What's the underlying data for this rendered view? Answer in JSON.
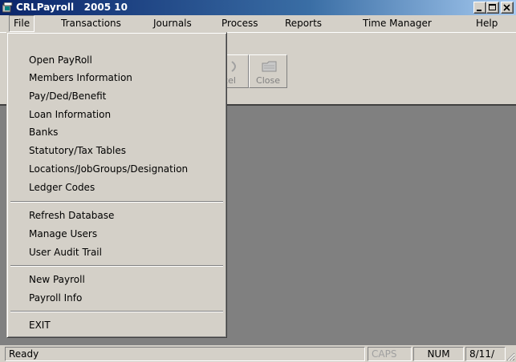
{
  "window": {
    "title": "CRLPayroll   2005 10",
    "controls": [
      "minimize",
      "maximize",
      "close"
    ]
  },
  "menubar": {
    "items": [
      {
        "label": "File",
        "active": true
      },
      {
        "label": "Transactions"
      },
      {
        "label": "Journals"
      },
      {
        "label": "Process"
      },
      {
        "label": "Reports"
      },
      {
        "label": "Time Manager"
      },
      {
        "label": "Help"
      }
    ]
  },
  "toolbar": {
    "buttons": [
      {
        "label": "cel",
        "icon": "cancel-icon"
      },
      {
        "label": "Close",
        "icon": "close-folder-icon"
      }
    ]
  },
  "file_menu": {
    "groups": [
      [
        "Open PayRoll",
        "Members Information",
        "Pay/Ded/Benefit",
        "Loan Information",
        "Banks",
        "Statutory/Tax Tables",
        "Locations/JobGroups/Designation",
        "Ledger Codes"
      ],
      [
        "Refresh Database",
        "Manage Users",
        "User Audit Trail"
      ],
      [
        "New Payroll",
        "Payroll Info"
      ],
      [
        "EXIT"
      ]
    ]
  },
  "statusbar": {
    "message": "Ready",
    "caps": "CAPS",
    "num": "NUM",
    "date": "8/11/"
  }
}
